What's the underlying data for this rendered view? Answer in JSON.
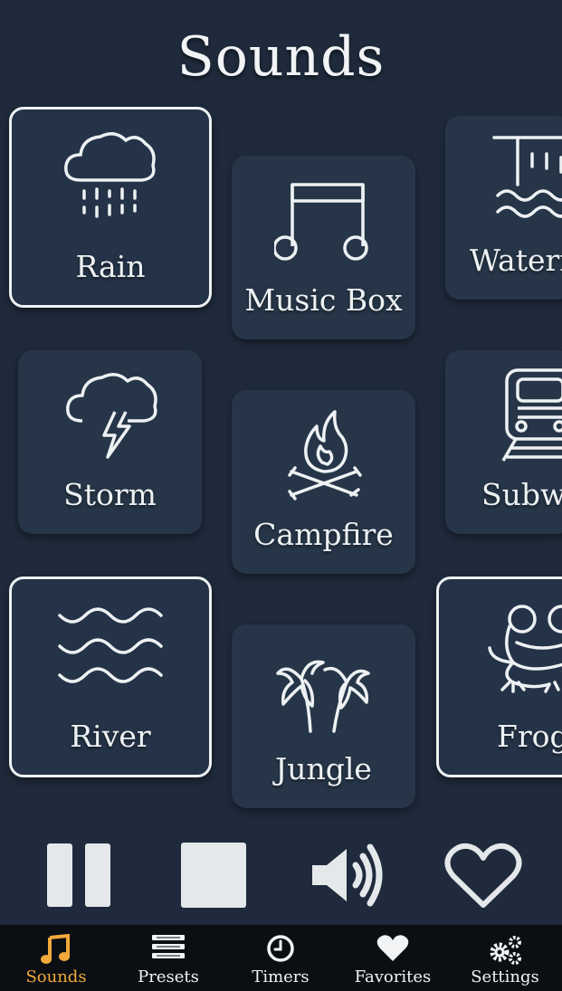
{
  "page": {
    "title": "Sounds"
  },
  "sounds": [
    {
      "label": "Rain",
      "icon": "rain-cloud-icon",
      "selected": true
    },
    {
      "label": "Music Box",
      "icon": "music-note-icon",
      "selected": false
    },
    {
      "label": "Waterf",
      "icon": "waterfall-icon",
      "selected": false
    },
    {
      "label": "Storm",
      "icon": "storm-cloud-icon",
      "selected": false
    },
    {
      "label": "Campfire",
      "icon": "campfire-icon",
      "selected": false
    },
    {
      "label": "Subw",
      "icon": "subway-train-icon",
      "selected": false
    },
    {
      "label": "River",
      "icon": "waves-icon",
      "selected": true
    },
    {
      "label": "Jungle",
      "icon": "palm-trees-icon",
      "selected": false
    },
    {
      "label": "Frog",
      "icon": "frog-icon",
      "selected": true
    }
  ],
  "controls": {
    "pause": "pause-icon",
    "stop": "stop-icon",
    "volume": "speaker-volume-icon",
    "favorite": "heart-outline-icon"
  },
  "nav": {
    "items": [
      {
        "label": "Sounds",
        "icon": "music-note-icon",
        "active": true
      },
      {
        "label": "Presets",
        "icon": "list-icon",
        "active": false
      },
      {
        "label": "Timers",
        "icon": "clock-icon",
        "active": false
      },
      {
        "label": "Favorites",
        "icon": "heart-icon",
        "active": false
      },
      {
        "label": "Settings",
        "icon": "gears-icon",
        "active": false
      }
    ]
  },
  "colors": {
    "background": "#1f2b3c",
    "tile": "#263648",
    "nav_background": "#0b0f14",
    "accent": "#f2a93b",
    "foreground": "#eef1f3"
  }
}
